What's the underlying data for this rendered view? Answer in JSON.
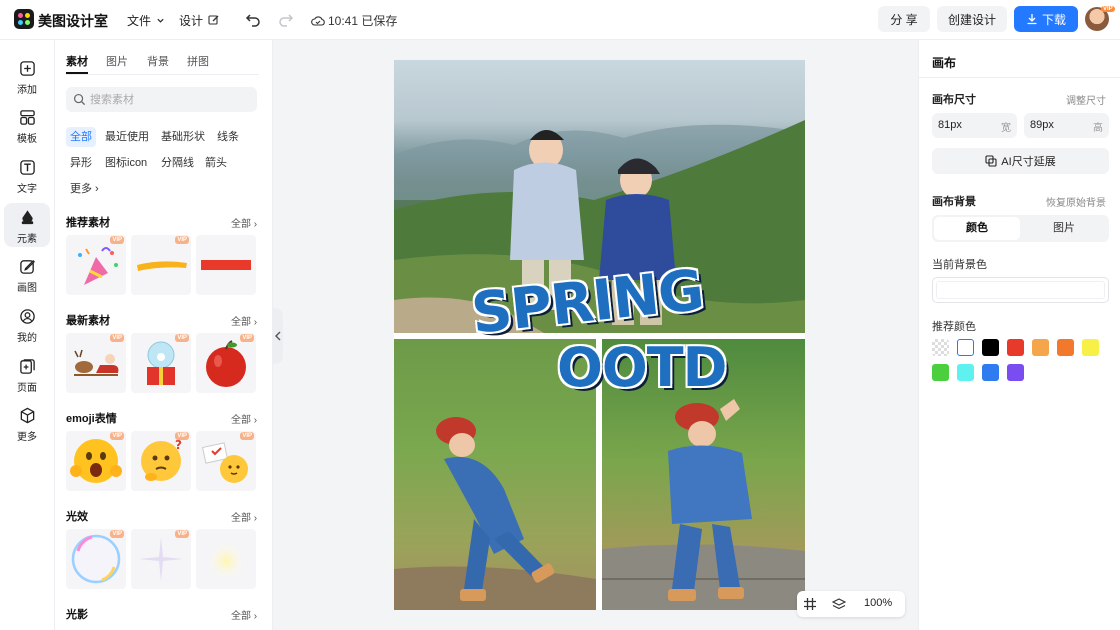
{
  "app": {
    "title": "美图设计室",
    "menu_file": "文件",
    "menu_design": "设计",
    "save_status": "10:41 已保存",
    "share_label": "分 享",
    "create_label": "创建设计",
    "download_label": "下载",
    "avatar_badge": "VIP",
    "accent_color": "#2379ff"
  },
  "rail": [
    {
      "label": "添加",
      "icon": "plus-square-icon"
    },
    {
      "label": "模板",
      "icon": "template-icon"
    },
    {
      "label": "文字",
      "icon": "text-icon"
    },
    {
      "label": "元素",
      "icon": "shapes-icon"
    },
    {
      "label": "画图",
      "icon": "draw-icon"
    },
    {
      "label": "我的",
      "icon": "user-icon"
    },
    {
      "label": "页面",
      "icon": "page-add-icon"
    },
    {
      "label": "更多",
      "icon": "cube-icon"
    }
  ],
  "panel": {
    "tabs": [
      "素材",
      "图片",
      "背景",
      "拼图"
    ],
    "search_placeholder": "搜索素材",
    "chips": [
      "全部",
      "最近使用",
      "基础形状",
      "线条",
      "异形",
      "图标icon",
      "分隔线",
      "箭头",
      "更多 ›"
    ],
    "all_label": "全部",
    "vip_label": "VIP",
    "sections": [
      {
        "title": "推荐素材",
        "items": [
          "party-popper",
          "yellow-brush-stroke",
          "red-bar"
        ]
      },
      {
        "title": "最新素材",
        "items": [
          "reindeer-sleigh",
          "snow-globe-gift",
          "red-apple"
        ]
      },
      {
        "title": "emoji表情",
        "items": [
          "shocked-emoji",
          "thinking-emoji",
          "love-letter-emoji"
        ]
      },
      {
        "title": "光效",
        "items": [
          "bubble-light",
          "sparkle-light",
          "glow-light"
        ]
      },
      {
        "title": "光影",
        "items": []
      }
    ]
  },
  "canvas": {
    "headline_1": "SPRING",
    "headline_2": "OOTD",
    "zoom": "100%"
  },
  "props": {
    "title": "画布",
    "size_label": "画布尺寸",
    "adjust_size_link": "调整尺寸",
    "width_value": "81px",
    "width_unit": "宽",
    "height_value": "89px",
    "height_unit": "高",
    "ai_extend_label": "AI尺寸延展",
    "bg_label": "画布背景",
    "restore_bg_link": "恢复原始背景",
    "seg_color": "颜色",
    "seg_image": "图片",
    "current_bg_label": "当前背景色",
    "recommend_label": "推荐颜色",
    "swatches": [
      "transparent",
      "#ffffff",
      "#000000",
      "#e83a2a",
      "#f5a64a",
      "#f2792c",
      "#f7f046",
      "#4ccf3e",
      "#5ff0f0",
      "#2f7bf0",
      "#7a4df0"
    ]
  }
}
